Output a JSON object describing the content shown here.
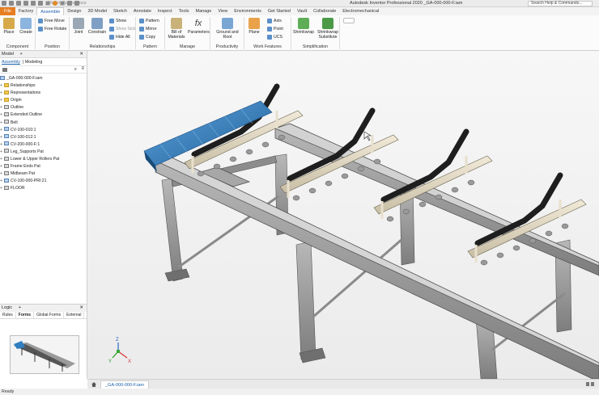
{
  "titlebar": {
    "material": "Material",
    "appearance": "Appearance",
    "title": "Autodesk Inventor Professional 2020   _GA-000-000-F.iam",
    "help_search": "Search Help & Commands..."
  },
  "tabs": [
    "File",
    "Factory",
    "Assemble",
    "Design",
    "3D Model",
    "Sketch",
    "Annotate",
    "Inspect",
    "Tools",
    "Manage",
    "View",
    "Environments",
    "Get Started",
    "Vault",
    "Collaborate",
    "Electromechanical"
  ],
  "active_tab": "Assemble",
  "ribbon": {
    "component": {
      "label": "Component",
      "place": "Place",
      "create": "Create"
    },
    "position": {
      "label": "Position",
      "free_move": "Free Move",
      "free_rotate": "Free Rotate"
    },
    "relationships": {
      "label": "Relationships",
      "joint": "Joint",
      "constrain": "Constrain",
      "show": "Show",
      "show_sick": "Show Sick",
      "hide_all": "Hide All"
    },
    "pattern": {
      "label": "Pattern",
      "pattern": "Pattern",
      "mirror": "Mirror",
      "copy": "Copy"
    },
    "manage": {
      "label": "Manage",
      "bom": "Bill of Materials",
      "parameters": "Parameters"
    },
    "productivity": {
      "label": "Productivity",
      "ground_root": "Ground and Root"
    },
    "work_features": {
      "label": "Work Features",
      "plane": "Plane",
      "axis": "Axis",
      "point": "Point",
      "ucs": "UCS"
    },
    "simplification": {
      "label": "Simplification",
      "shrinkwrap": "Shrinkwrap",
      "shrinkwrap_sub": "Shrinkwrap Substitute"
    }
  },
  "browser": {
    "title": "Model",
    "tab_assembly": "Assembly",
    "tab_modeling": "Modeling",
    "root": "_GA-000-000-F.iam",
    "nodes": [
      {
        "label": "Relationships",
        "icon": "folder"
      },
      {
        "label": "Representations",
        "icon": "folder"
      },
      {
        "label": "Origin",
        "icon": "folder"
      },
      {
        "label": "Outline",
        "icon": "part"
      },
      {
        "label": "Extended Outline",
        "icon": "part"
      },
      {
        "label": "Belt",
        "icon": "part"
      },
      {
        "label": "CV-100-010:1",
        "icon": "asm"
      },
      {
        "label": "CV-100-012:1",
        "icon": "asm"
      },
      {
        "label": "CV-200-000-F:1",
        "icon": "asm"
      },
      {
        "label": "Leg_Supports Pat",
        "icon": "part"
      },
      {
        "label": "Lower & Upper Rollers Pat",
        "icon": "part"
      },
      {
        "label": "Frame Ends Pat",
        "icon": "part"
      },
      {
        "label": "Midbeam Pat",
        "icon": "part"
      },
      {
        "label": "CV-100-000-PRI:21",
        "icon": "asm"
      },
      {
        "label": "FLOOR",
        "icon": "part"
      }
    ]
  },
  "logic": {
    "title": "Logic",
    "tabs": [
      "Rules",
      "Forms",
      "Global Forms",
      "External"
    ],
    "active": "Forms"
  },
  "viewcube": {
    "x": "X",
    "y": "Y",
    "z": "Z"
  },
  "document_tab": "_GA-000-000-F.iam",
  "status": "Ready",
  "colors": {
    "file_tab": "#e67e22",
    "accent": "#1b5fa8",
    "belt": "#2f7fc1",
    "roller": "#1e1e1e",
    "frame": "#8f8f8f"
  }
}
